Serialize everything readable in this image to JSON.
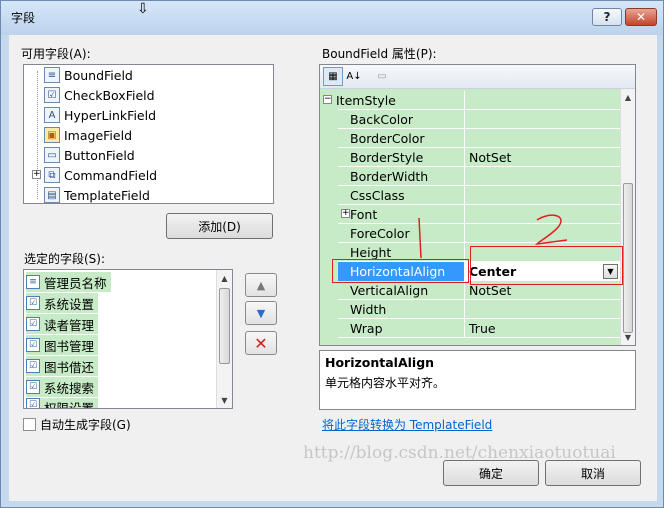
{
  "window": {
    "title": "字段",
    "help_label": "?",
    "close_label": "✕"
  },
  "available_fields": {
    "label": "可用字段(A):",
    "items": [
      {
        "label": "BoundField",
        "icon": "boundfield-icon"
      },
      {
        "label": "CheckBoxField",
        "icon": "checkboxfield-icon"
      },
      {
        "label": "HyperLinkField",
        "icon": "hyperlinkfield-icon"
      },
      {
        "label": "ImageField",
        "icon": "imagefield-icon"
      },
      {
        "label": "ButtonField",
        "icon": "buttonfield-icon"
      },
      {
        "label": "CommandField",
        "icon": "commandfield-icon"
      },
      {
        "label": "TemplateField",
        "icon": "templatefield-icon"
      }
    ],
    "add_button": "添加(D)"
  },
  "selected_fields": {
    "label": "选定的字段(S):",
    "items": [
      {
        "label": "管理员名称"
      },
      {
        "label": "系统设置"
      },
      {
        "label": "读者管理"
      },
      {
        "label": "图书管理"
      },
      {
        "label": "图书借还"
      },
      {
        "label": "系统搜索"
      },
      {
        "label": "权限设置"
      }
    ]
  },
  "auto_generate": {
    "label": "自动生成字段(G)",
    "checked": false
  },
  "properties": {
    "label": "BoundField 属性(P):",
    "rows": [
      {
        "name": "ItemStyle",
        "value": "",
        "category": true,
        "expander": "−"
      },
      {
        "name": "BackColor",
        "value": ""
      },
      {
        "name": "BorderColor",
        "value": ""
      },
      {
        "name": "BorderStyle",
        "value": "NotSet"
      },
      {
        "name": "BorderWidth",
        "value": ""
      },
      {
        "name": "CssClass",
        "value": ""
      },
      {
        "name": "Font",
        "value": "",
        "expander": "+"
      },
      {
        "name": "ForeColor",
        "value": ""
      },
      {
        "name": "Height",
        "value": ""
      },
      {
        "name": "HorizontalAlign",
        "value": "Center",
        "selected": true
      },
      {
        "name": "VerticalAlign",
        "value": "NotSet"
      },
      {
        "name": "Width",
        "value": ""
      },
      {
        "name": "Wrap",
        "value": "True"
      }
    ]
  },
  "description": {
    "title": "HorizontalAlign",
    "text": "单元格内容水平对齐。"
  },
  "convert_link": "将此字段转换为 TemplateField",
  "buttons": {
    "ok": "确定",
    "cancel": "取消"
  },
  "watermark": "http://blog.csdn.net/chenxiaotuotuai",
  "colors": {
    "selection": "#3399ff",
    "grid_bg": "#c7ebc7",
    "annotation": "#e02020"
  }
}
